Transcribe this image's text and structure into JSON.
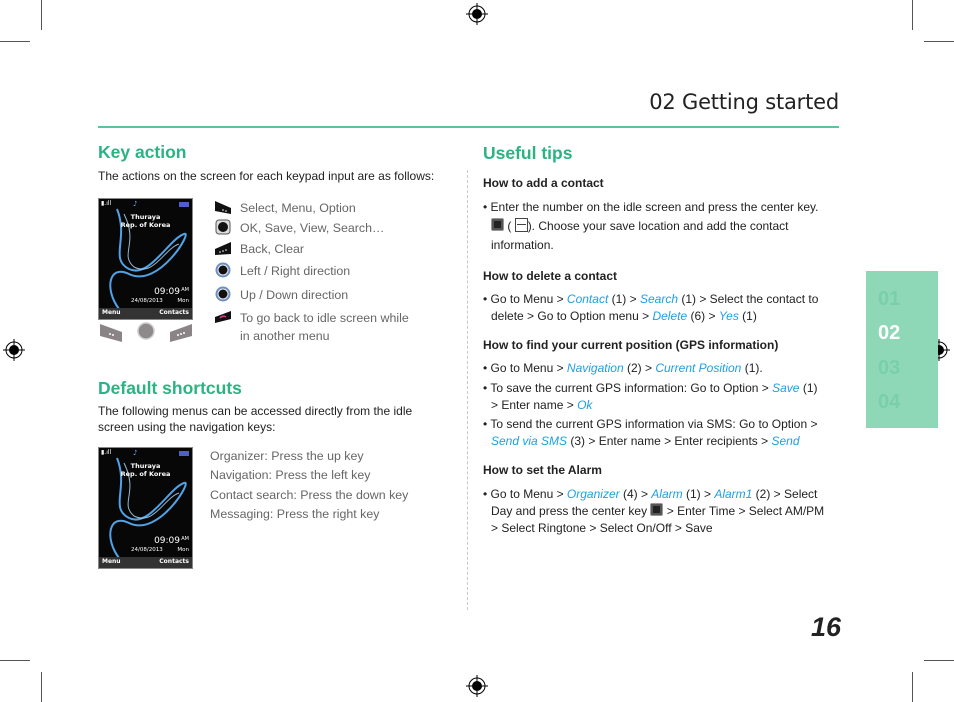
{
  "header": {
    "chapter_title": "02 Getting started"
  },
  "key_action": {
    "heading": "Key action",
    "intro": "The actions on the screen for each keypad input are as follows:",
    "phone_screen": {
      "network_line1": "Thuraya",
      "network_line2": "Rep. of Korea",
      "time": "09:09",
      "ampm": "AM",
      "date": "24/08/2013",
      "day": "Mon",
      "left_softkey": "Menu",
      "right_softkey": "Contacts"
    },
    "keys": [
      {
        "icon": "left-softkey-icon",
        "label": "Select, Menu, Option"
      },
      {
        "icon": "center-key-icon",
        "label": "OK, Save, View, Search…"
      },
      {
        "icon": "right-softkey-icon",
        "label": "Back, Clear"
      },
      {
        "icon": "left-right-navigation-icon",
        "label": "Left / Right direction"
      },
      {
        "icon": "up-down-navigation-icon",
        "label": "Up / Down direction"
      },
      {
        "icon": "end-call-key-icon",
        "label": "To go back to idle screen while",
        "label2": "in another menu"
      }
    ]
  },
  "default_shortcuts": {
    "heading": "Default shortcuts",
    "intro_line1": "The following menus can be accessed directly from the idle",
    "intro_line2": "screen using the navigation keys:",
    "items": [
      "Organizer: Press the up key",
      "Navigation: Press the left key",
      "Contact search: Press the down key",
      "Messaging: Press the right key"
    ]
  },
  "useful_tips": {
    "heading": "Useful tips",
    "add_contact": {
      "title": "How to add a contact",
      "line1": "• Enter the number on the idle screen and press the center key.",
      "line2_pre": "(",
      "line2_post": "). Choose your save location and add the contact",
      "line3": "information."
    },
    "delete_contact": {
      "title": "How to delete a contact",
      "t1": "• Go to Menu > ",
      "l1": "Contact",
      "t2": " (1) > ",
      "l2": "Search",
      "t3": " (1) > Select the contact to",
      "t4": "delete > Go to Option menu > ",
      "l3": "Delete",
      "t5": " (6) > ",
      "l4": "Yes",
      "t6": " (1)"
    },
    "gps": {
      "title": "How to find your current position (GPS information)",
      "b1_t1": "• Go to Menu > ",
      "b1_l1": "Navigation",
      "b1_t2": " (2) > ",
      "b1_l2": "Current Position",
      "b1_t3": " (1).",
      "b2_t1": "• To save the current GPS information: Go to Option > ",
      "b2_l1": "Save",
      "b2_t2": " (1)",
      "b2_t3": "> Enter name > ",
      "b2_l2": "Ok",
      "b3_t1": "• To send the current GPS information via SMS: Go to Option >",
      "b3_l1": "Send via SMS",
      "b3_t2": " (3) > Enter name > Enter recipients > ",
      "b3_l2": "Send"
    },
    "alarm": {
      "title": "How to set the Alarm",
      "t1": "• Go to Menu > ",
      "l1": "Organizer",
      "t2": " (4) > ",
      "l2": "Alarm",
      "t3": " (1) > ",
      "l3": "Alarm1",
      "t4": " (2) > Select",
      "t5": "Day and press the center key ",
      "t6": " > Enter Time > Select AM/PM",
      "t7": "> Select Ringtone > Select On/Off > Save"
    }
  },
  "side_tabs": [
    "01",
    "02",
    "03",
    "04"
  ],
  "active_tab": "02",
  "page_number": "16",
  "colors": {
    "accent_green": "#2bb383",
    "rule_green": "#5cc49a",
    "tab_green": "#8ed8b7",
    "link_blue": "#1ea0e0"
  }
}
